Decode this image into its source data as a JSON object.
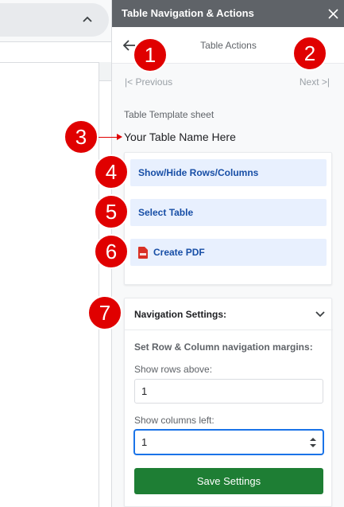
{
  "sidebar": {
    "title": "Table Navigation & Actions",
    "nav_title": "Table Actions",
    "prev_label": "|< Previous",
    "next_label": "Next >|",
    "template_label": "Table Template sheet",
    "table_name": "Your Table Name Here"
  },
  "actions": [
    {
      "label": "Show/Hide Rows/Columns"
    },
    {
      "label": "Select Table"
    },
    {
      "label": "Create PDF",
      "icon": "pdf-icon"
    }
  ],
  "settings": {
    "title": "Navigation Settings:",
    "margins_label": "Set Row & Column navigation margins:",
    "rows_label": "Show rows above:",
    "rows_value": "1",
    "cols_label": "Show columns left:",
    "cols_value": "1",
    "save_label": "Save Settings"
  },
  "callouts": [
    "1",
    "2",
    "3",
    "4",
    "5",
    "6",
    "7"
  ],
  "colors": {
    "header_bg": "#5f6368",
    "action_bg": "#e8f0fe",
    "action_text": "#174ea6",
    "save_bg": "#1e7e34",
    "callout": "#e00000",
    "focus": "#1a73e8"
  }
}
